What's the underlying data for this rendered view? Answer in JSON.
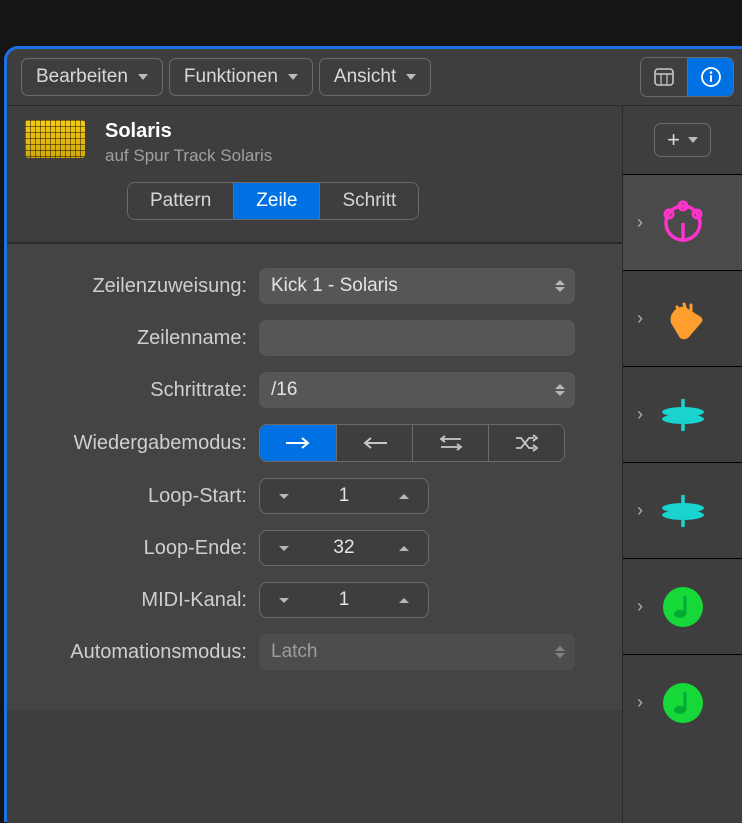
{
  "toolbar": {
    "edit": "Bearbeiten",
    "functions": "Funktionen",
    "view": "Ansicht"
  },
  "header": {
    "title": "Solaris",
    "subtitle": "auf Spur Track Solaris"
  },
  "tabs": {
    "pattern": "Pattern",
    "row": "Zeile",
    "step": "Schritt"
  },
  "form": {
    "rowAssign": {
      "label": "Zeilenzuweisung:",
      "value": "Kick 1 - Solaris"
    },
    "rowName": {
      "label": "Zeilenname:",
      "value": ""
    },
    "stepRate": {
      "label": "Schrittrate:",
      "value": "/16"
    },
    "playMode": {
      "label": "Wiedergabemodus:"
    },
    "loopStart": {
      "label": "Loop-Start:",
      "value": "1"
    },
    "loopEnd": {
      "label": "Loop-Ende:",
      "value": "32"
    },
    "midiChan": {
      "label": "MIDI-Kanal:",
      "value": "1"
    },
    "autoMode": {
      "label": "Automationsmodus:",
      "value": "Latch"
    }
  },
  "addLabel": "+",
  "colors": {
    "accent": "#0071e3",
    "pink": "#ff33cc",
    "orange": "#ff9d2e",
    "teal": "#19d3cf",
    "green": "#16d839"
  }
}
